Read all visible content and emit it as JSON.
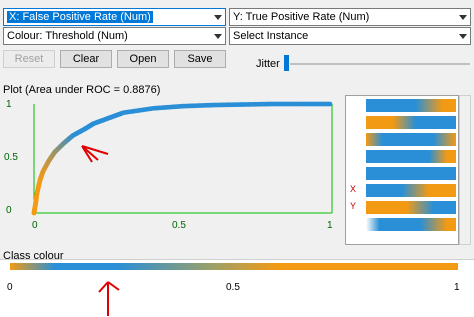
{
  "selectors": {
    "x_axis": "X: False Positive Rate (Num)",
    "y_axis": "Y: True Positive Rate (Num)",
    "colour": "Colour: Threshold (Num)",
    "instance": "Select Instance"
  },
  "buttons": {
    "reset": "Reset",
    "clear": "Clear",
    "open": "Open",
    "save": "Save"
  },
  "jitter_label": "Jitter",
  "plot": {
    "title": "Plot (Area under ROC = 0.8876)"
  },
  "chart_data": {
    "type": "scatter",
    "xlim": [
      0,
      1
    ],
    "ylim": [
      0,
      1
    ],
    "x_ticks": [
      "0",
      "0.5",
      "1"
    ],
    "y_ticks": [
      "0",
      "0.5",
      "1"
    ],
    "x": [
      0.0,
      0.005,
      0.01,
      0.02,
      0.03,
      0.05,
      0.07,
      0.1,
      0.13,
      0.17,
      0.2,
      0.25,
      0.3,
      0.4,
      0.5,
      0.6,
      0.7,
      0.8,
      0.9,
      1.0
    ],
    "y": [
      0.0,
      0.08,
      0.18,
      0.3,
      0.38,
      0.48,
      0.56,
      0.64,
      0.71,
      0.77,
      0.82,
      0.87,
      0.92,
      0.96,
      0.98,
      0.99,
      0.995,
      1.0,
      1.0,
      1.0
    ]
  },
  "instance_panel": {
    "x_tag": "X",
    "y_tag": "Y"
  },
  "class_colour": {
    "label": "Class colour",
    "ticks": [
      "0",
      "0.5",
      "1"
    ]
  },
  "colors": {
    "orange": "#f39a14",
    "blue": "#2a8fd6",
    "axis_green": "#006400",
    "annotation_red": "#e00000"
  }
}
